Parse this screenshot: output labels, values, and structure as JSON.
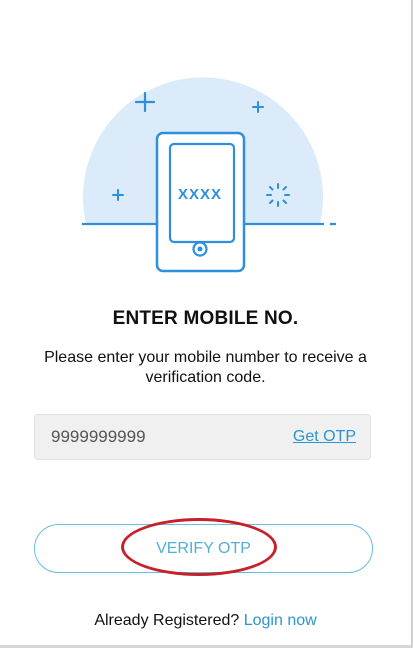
{
  "illustration": {
    "code_text": "XXXX",
    "circle_color": "#dcebf9",
    "line_color": "#2e8fdc"
  },
  "heading": "ENTER MOBILE NO.",
  "subtitle": "Please enter your mobile number to receive a verification code.",
  "mobile": {
    "value": "9999999999",
    "placeholder": "",
    "get_otp_label": "Get OTP"
  },
  "verify_button": {
    "label": "VERIFY OTP",
    "color": "#52b0d6"
  },
  "annotation": {
    "color": "#c8202a"
  },
  "footer": {
    "prompt": "Already Registered?",
    "link": "Login now"
  }
}
